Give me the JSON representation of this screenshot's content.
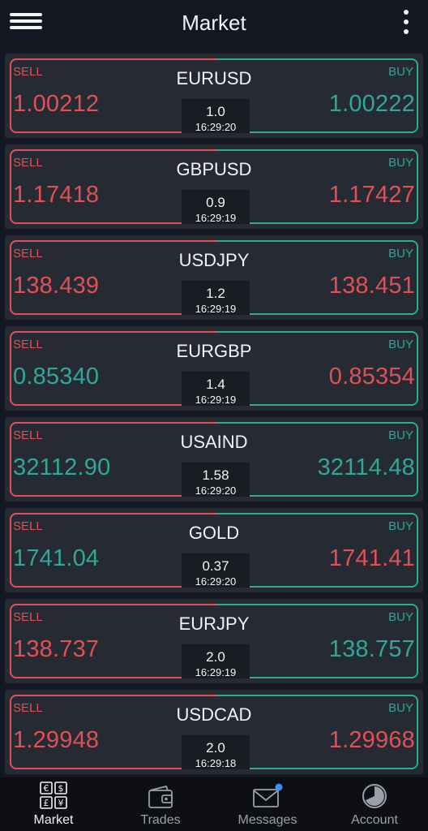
{
  "header": {
    "title": "Market"
  },
  "rows": [
    {
      "symbol": "EURUSD",
      "sell_label": "SELL",
      "buy_label": "BUY",
      "sell": "1.00212",
      "buy": "1.00222",
      "sell_dir": "down",
      "buy_dir": "up",
      "spread": "1.0",
      "time": "16:29:20"
    },
    {
      "symbol": "GBPUSD",
      "sell_label": "SELL",
      "buy_label": "BUY",
      "sell": "1.17418",
      "buy": "1.17427",
      "sell_dir": "down",
      "buy_dir": "down",
      "spread": "0.9",
      "time": "16:29:19"
    },
    {
      "symbol": "USDJPY",
      "sell_label": "SELL",
      "buy_label": "BUY",
      "sell": "138.439",
      "buy": "138.451",
      "sell_dir": "down",
      "buy_dir": "down",
      "spread": "1.2",
      "time": "16:29:19"
    },
    {
      "symbol": "EURGBP",
      "sell_label": "SELL",
      "buy_label": "BUY",
      "sell": "0.85340",
      "buy": "0.85354",
      "sell_dir": "up",
      "buy_dir": "down",
      "spread": "1.4",
      "time": "16:29:19"
    },
    {
      "symbol": "USAIND",
      "sell_label": "SELL",
      "buy_label": "BUY",
      "sell": "32112.90",
      "buy": "32114.48",
      "sell_dir": "up",
      "buy_dir": "up",
      "spread": "1.58",
      "time": "16:29:20"
    },
    {
      "symbol": "GOLD",
      "sell_label": "SELL",
      "buy_label": "BUY",
      "sell": "1741.04",
      "buy": "1741.41",
      "sell_dir": "up",
      "buy_dir": "down",
      "spread": "0.37",
      "time": "16:29:20"
    },
    {
      "symbol": "EURJPY",
      "sell_label": "SELL",
      "buy_label": "BUY",
      "sell": "138.737",
      "buy": "138.757",
      "sell_dir": "down",
      "buy_dir": "up",
      "spread": "2.0",
      "time": "16:29:19"
    },
    {
      "symbol": "USDCAD",
      "sell_label": "SELL",
      "buy_label": "BUY",
      "sell": "1.29948",
      "buy": "1.29968",
      "sell_dir": "down",
      "buy_dir": "down",
      "spread": "2.0",
      "time": "16:29:18"
    }
  ],
  "tabs": [
    {
      "label": "Market",
      "icon": "currency-icon",
      "active": true
    },
    {
      "label": "Trades",
      "icon": "wallet-icon",
      "active": false
    },
    {
      "label": "Messages",
      "icon": "mail-icon",
      "active": false,
      "badge": true
    },
    {
      "label": "Account",
      "icon": "pie-chart-icon",
      "active": false
    }
  ],
  "colors": {
    "up": "#2ea89a",
    "down": "#e34f56",
    "background": "#131722",
    "card": "#262a33"
  }
}
